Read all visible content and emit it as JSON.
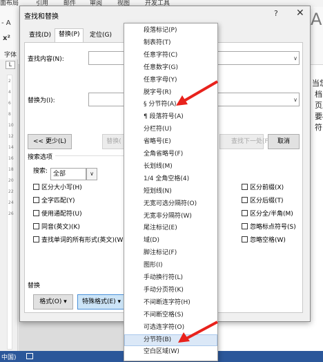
{
  "ribbon": {
    "tabs": [
      "面布局",
      "引用",
      "邮件",
      "审阅",
      "视图",
      "开发工具"
    ],
    "left_glyphs": [
      "- A",
      "x²",
      "字体",
      "L"
    ],
    "big_a": "A"
  },
  "status": {
    "language": "中国)"
  },
  "document": {
    "lines": [
      "当您",
      "档的",
      "页眉",
      "要标",
      "符(T"
    ],
    "ruler_ticks": [
      "2",
      "4",
      "6",
      "8",
      "10",
      "12",
      "14",
      "16",
      "18",
      "20",
      "22",
      "24",
      "26"
    ]
  },
  "dialog": {
    "title": "查找和替换",
    "help": "?",
    "close": "✕",
    "tabs": [
      "查找(D)",
      "替换(P)",
      "定位(G)"
    ],
    "find_label": "查找内容(N):",
    "replace_label": "替换为(I):",
    "buttons": {
      "less": "<< 更少(L)",
      "replace_hidden": "替换(",
      "find_next_hidden": "查找下一处(F)",
      "cancel": "取消",
      "format": "格式(O) ▾",
      "special": "特殊格式(E) ▾"
    },
    "search_options_label": "搜索选项",
    "search_label": "搜索:",
    "search_value": "全部",
    "checkboxes_left": [
      "区分大小写(H)",
      "全字匹配(Y)",
      "使用通配符(U)",
      "同音(英文)(K)",
      "查找单词的所有形式(英文)(W)"
    ],
    "checkboxes_right": [
      "区分前缀(X)",
      "区分后缀(T)",
      "区分全/半角(M)",
      "忽略标点符号(S)",
      "忽略空格(W)"
    ],
    "replace_section_label": "替换"
  },
  "special_menu": {
    "items": [
      "段落标记(P)",
      "制表符(T)",
      "任意字符(C)",
      "任意数字(G)",
      "任意字母(Y)",
      "脱字号(R)",
      "§ 分节符(A)",
      "¶ 段落符号(A)",
      "分栏符(U)",
      "省略号(E)",
      "全角省略号(F)",
      "长划线(M)",
      "1/4 全角空格(4)",
      "短划线(N)",
      "无宽可选分隔符(O)",
      "无宽非分隔符(W)",
      "尾注标记(E)",
      "域(D)",
      "脚注标记(F)",
      "图形(I)",
      "手动换行符(L)",
      "手动分页符(K)",
      "不间断连字符(H)",
      "不间断空格(S)",
      "可选连字符(O)",
      "分节符(B)",
      "空白区域(W)"
    ],
    "highlighted_index": 25
  },
  "colors": {
    "arrow": "#e8221c",
    "status_bar": "#2b579a",
    "menu_highlight": "#dbe8f7"
  }
}
